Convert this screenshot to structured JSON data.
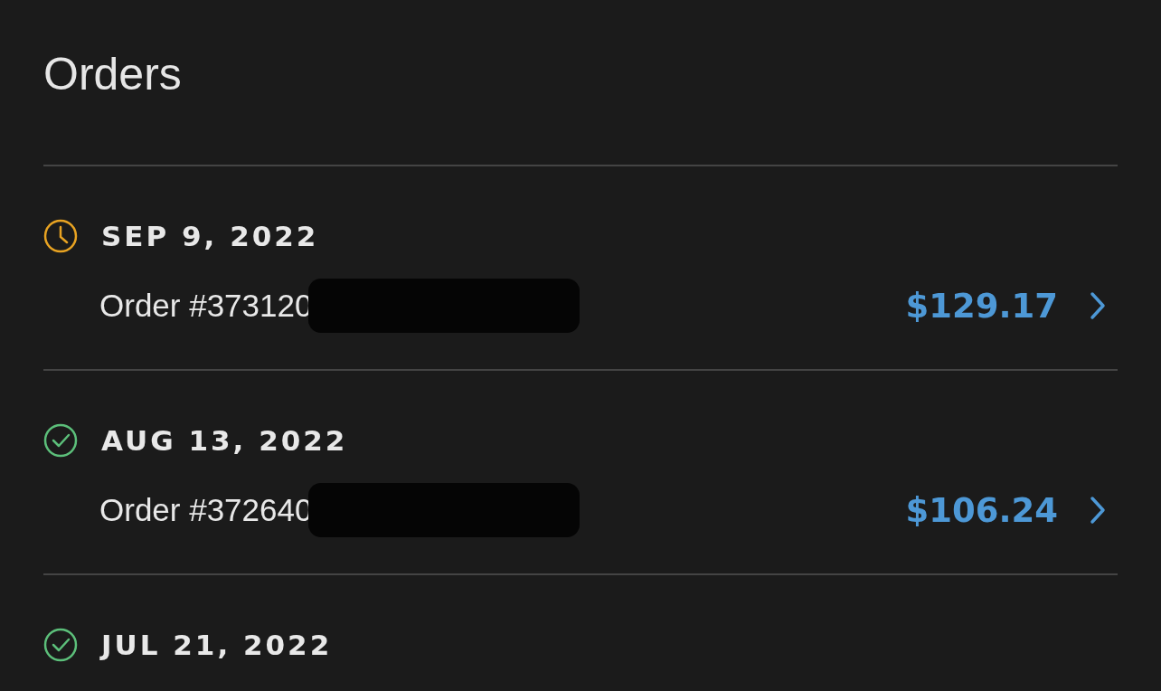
{
  "title": "Orders",
  "orders": [
    {
      "kind": "pending",
      "date": "SEP 9, 2022",
      "order": "Order #373120",
      "amount": "$129.17"
    },
    {
      "kind": "complete",
      "date": "AUG 13, 2022",
      "order": "Order #372640",
      "amount": "$106.24"
    },
    {
      "kind": "complete",
      "date": "JUL 21, 2022"
    }
  ]
}
